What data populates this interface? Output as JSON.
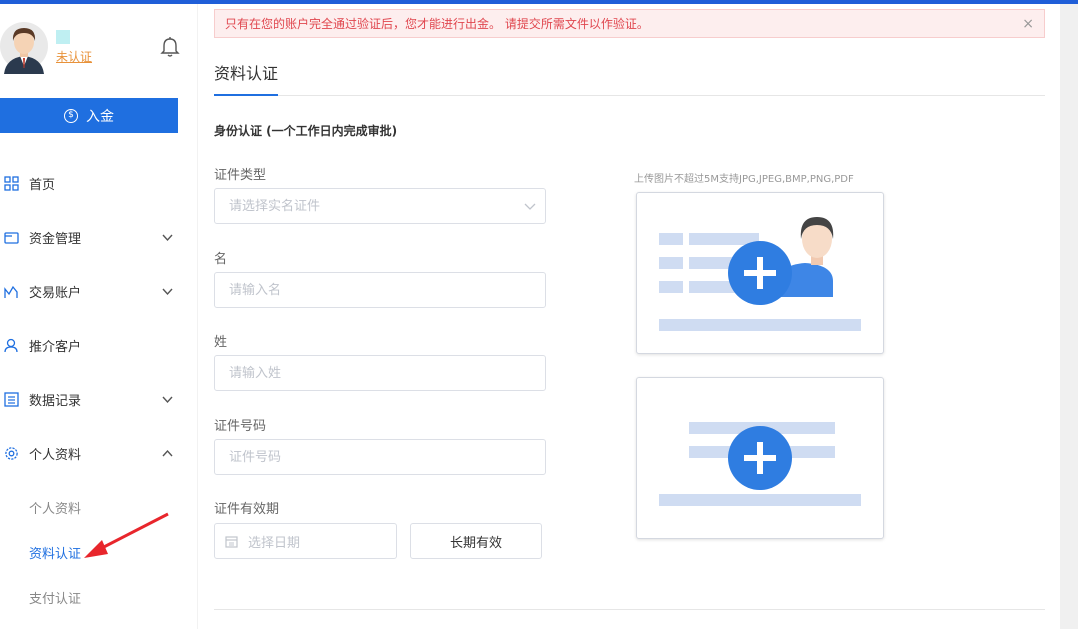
{
  "sidebar": {
    "status": "未认证",
    "deposit_label": "入金",
    "nav": [
      {
        "label": "首页",
        "icon": "dashboard-icon"
      },
      {
        "label": "资金管理",
        "icon": "wallet-icon"
      },
      {
        "label": "交易账户",
        "icon": "chart-icon"
      },
      {
        "label": "推介客户",
        "icon": "user-icon"
      },
      {
        "label": "数据记录",
        "icon": "list-icon"
      },
      {
        "label": "个人资料",
        "icon": "gear-icon"
      }
    ],
    "sub_items": [
      "个人资料",
      "资料认证",
      "支付认证"
    ]
  },
  "alert": {
    "text": "只有在您的账户完全通过验证后，您才能进行出金。 请提交所需文件以作验证。",
    "close": "×"
  },
  "page": {
    "title": "资料认证",
    "section_title": "身份认证 (一个工作日内完成审批)"
  },
  "form": {
    "doc_type_label": "证件类型",
    "doc_type_placeholder": "请选择实名证件",
    "first_name_label": "名",
    "first_name_placeholder": "请输入名",
    "last_name_label": "姓",
    "last_name_placeholder": "请输入姓",
    "doc_number_label": "证件号码",
    "doc_number_placeholder": "证件号码",
    "expiry_label": "证件有效期",
    "date_placeholder": "选择日期",
    "long_term_label": "长期有效"
  },
  "upload": {
    "hint": "上传图片不超过5M支持JPG,JPEG,BMP,PNG,PDF"
  },
  "colors": {
    "primary": "#1f6fe0",
    "alert_text": "#e0474f",
    "unverified": "#e8923a"
  }
}
